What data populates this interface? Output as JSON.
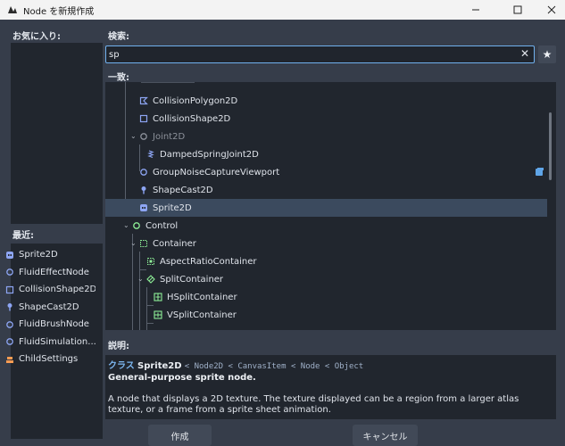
{
  "window": {
    "title": "Node を新規作成"
  },
  "favorites": {
    "label": "お気に入り:"
  },
  "recent": {
    "label": "最近:",
    "items": [
      {
        "label": "Sprite2D",
        "icon": "sprite-icon"
      },
      {
        "label": "FluidEffectNode",
        "icon": "node-circle-icon"
      },
      {
        "label": "CollisionShape2D",
        "icon": "collision-shape-icon"
      },
      {
        "label": "ShapeCast2D",
        "icon": "shapecast-icon"
      },
      {
        "label": "FluidBrushNode",
        "icon": "node-circle-icon"
      },
      {
        "label": "FluidSimulation...",
        "icon": "node-circle-icon"
      },
      {
        "label": "ChildSettings",
        "icon": "script-node-icon"
      }
    ]
  },
  "search": {
    "label": "検索:",
    "value": "sp",
    "placeholder": ""
  },
  "matches": {
    "label": "一致:",
    "rows": [
      {
        "label": "CollisionPolygon2D",
        "icon": "collision-polygon-icon"
      },
      {
        "label": "CollisionShape2D",
        "icon": "collision-shape-icon"
      },
      {
        "label": "Joint2D",
        "icon": "joint-icon"
      },
      {
        "label": "DampedSpringJoint2D",
        "icon": "spring-joint-icon"
      },
      {
        "label": "GroupNoiseCaptureViewport",
        "icon": "node-circle-icon"
      },
      {
        "label": "ShapeCast2D",
        "icon": "shapecast-icon"
      },
      {
        "label": "Sprite2D",
        "icon": "sprite-icon"
      },
      {
        "label": "Control",
        "icon": "control-icon"
      },
      {
        "label": "Container",
        "icon": "container-icon"
      },
      {
        "label": "AspectRatioContainer",
        "icon": "aspect-ratio-container-icon"
      },
      {
        "label": "SplitContainer",
        "icon": "split-container-icon"
      },
      {
        "label": "HSplitContainer",
        "icon": "hsplit-container-icon"
      },
      {
        "label": "VSplitContainer",
        "icon": "vsplit-container-icon"
      }
    ]
  },
  "description": {
    "label": "説明:",
    "class_prefix": "クラス",
    "class_name": "Sprite2D",
    "inheritance": "< Node2D < CanvasItem < Node < Object",
    "summary": "General-purpose sprite node.",
    "body": "A node that displays a 2D texture. The texture displayed can be a region from a larger atlas texture, or a frame from a sprite sheet animation."
  },
  "buttons": {
    "create": "作成",
    "cancel": "キャンセル"
  }
}
